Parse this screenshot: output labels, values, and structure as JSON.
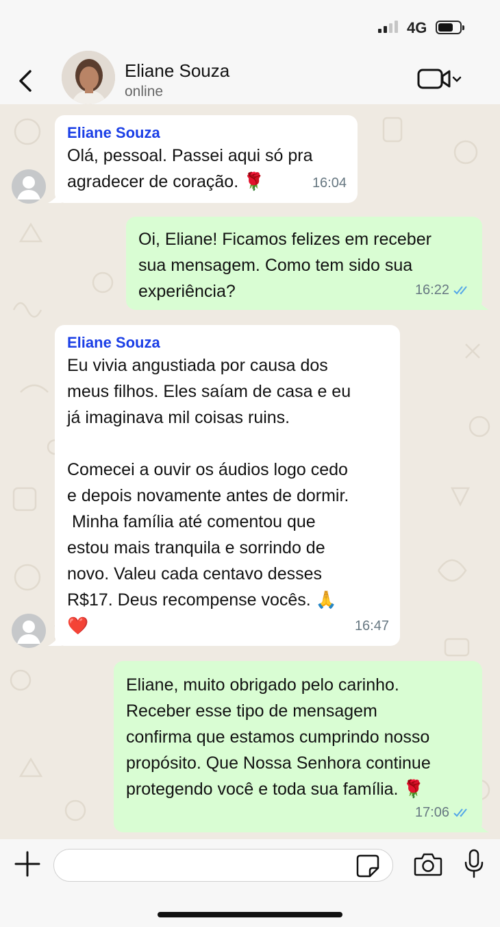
{
  "status_bar": {
    "network": "4G",
    "battery_level": 0.7
  },
  "header": {
    "contact_name": "Eliane Souza",
    "status": "online"
  },
  "messages": [
    {
      "direction": "in",
      "sender": "Eliane Souza",
      "text": "Olá, pessoal. Passei aqui só pra\nagradecer de coração. 🌹",
      "time": "16:04"
    },
    {
      "direction": "out",
      "text": "Oi, Eliane! Ficamos felizes em receber\nsua mensagem. Como tem sido sua\nexperiência?",
      "time": "16:22",
      "status": "read"
    },
    {
      "direction": "in",
      "sender": "Eliane Souza",
      "text": "Eu vivia angustiada por causa dos\nmeus filhos. Eles saíam de casa e eu\njá imaginava mil coisas ruins.\n\nComecei a ouvir os áudios logo cedo\ne depois novamente antes de dormir.\n Minha família até comentou que\nestou mais tranquila e sorrindo de\nnovo. Valeu cada centavo desses\nR$17. Deus recompense vocês. 🙏\n❤️",
      "time": "16:47"
    },
    {
      "direction": "out",
      "text": "Eliane, muito obrigado pelo carinho.\nReceber esse tipo de mensagem\nconfirma que estamos cumprindo nosso\npropósito. Que Nossa Senhora continue\nprotegendo você e toda sua família. 🌹",
      "time": "17:06",
      "status": "read"
    }
  ],
  "input": {
    "placeholder": ""
  },
  "colors": {
    "sender": "#1a3ee6",
    "outgoing_bubble": "#d9fdd3",
    "read_ticks": "#53a6e8",
    "chat_bg": "#efeae2"
  }
}
